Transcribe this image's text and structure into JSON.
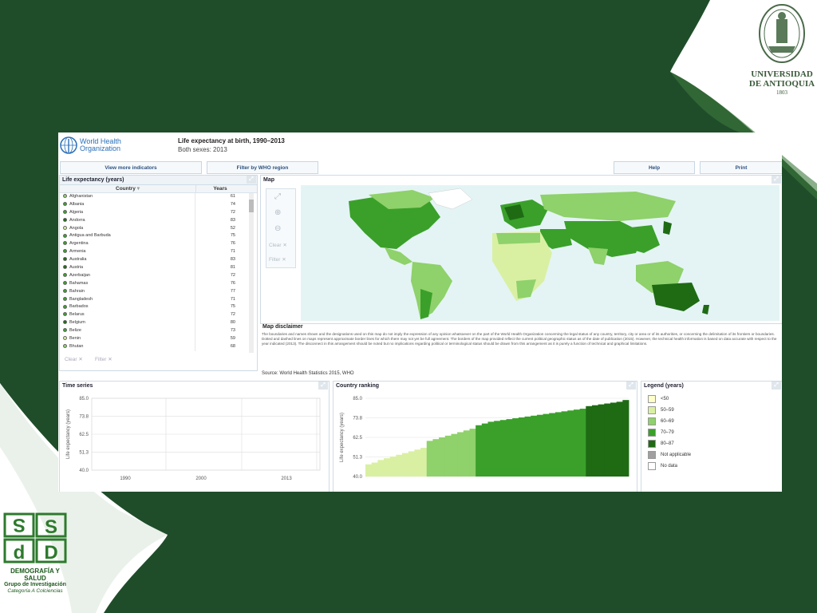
{
  "slide": {
    "colors": {
      "dark_green": "#1f4d2a",
      "accent_green": "#2d7a2d"
    },
    "udea_logo": {
      "name": "UNIVERSIDAD DE ANTIOQUIA",
      "line1": "UNIVERSIDAD",
      "line2": "DE ANTIOQUIA",
      "year": "1803"
    },
    "ds_logo": {
      "line1": "DEMOGRAFÍA Y SALUD",
      "line2": "Grupo de Investigación",
      "line3": "Categoría A Colciencias"
    }
  },
  "who": {
    "org_line1": "World Health",
    "org_line2": "Organization",
    "title": "Life expectancy at birth, 1990–2013",
    "subtitle": "Both sexes: 2013",
    "buttons": {
      "more": "View more indicators",
      "filter": "Filter by WHO region",
      "help": "Help",
      "print": "Print"
    },
    "list_panel": {
      "title": "Life expectancy (years)",
      "col_country": "Country",
      "col_years": "Years",
      "rows": [
        {
          "country": "Afghanistan",
          "years": "61"
        },
        {
          "country": "Albania",
          "years": "74"
        },
        {
          "country": "Algeria",
          "years": "72"
        },
        {
          "country": "Andorra",
          "years": "83"
        },
        {
          "country": "Angola",
          "years": "52"
        },
        {
          "country": "Antigua and Barbuda",
          "years": "75"
        },
        {
          "country": "Argentina",
          "years": "76"
        },
        {
          "country": "Armenia",
          "years": "71"
        },
        {
          "country": "Australia",
          "years": "83"
        },
        {
          "country": "Austria",
          "years": "81"
        },
        {
          "country": "Azerbaijan",
          "years": "72"
        },
        {
          "country": "Bahamas",
          "years": "76"
        },
        {
          "country": "Bahrain",
          "years": "77"
        },
        {
          "country": "Bangladesh",
          "years": "71"
        },
        {
          "country": "Barbados",
          "years": "75"
        },
        {
          "country": "Belarus",
          "years": "72"
        },
        {
          "country": "Belgium",
          "years": "80"
        },
        {
          "country": "Belize",
          "years": "73"
        },
        {
          "country": "Benin",
          "years": "59"
        },
        {
          "country": "Bhutan",
          "years": "68"
        }
      ],
      "clear": "Clear",
      "filter": "Filter"
    },
    "map_panel": {
      "title": "Map",
      "clear": "Clear",
      "filter": "Filter"
    },
    "disclaimer": {
      "title": "Map disclaimer",
      "text": "The boundaries and names shown and the designations used on this map do not imply the expression of any opinion whatsoever on the part of the World Health Organization concerning the legal status of any country, territory, city or area or of its authorities, or concerning the delimitation of its frontiers or boundaries. Dotted and dashed lines on maps represent approximate border lines for which there may not yet be full agreement. The borders of the map provided reflect the current political geographic status as of the date of publication (2015). However, the technical health information is based on data accurate with respect to the year indicated (2013). The disconnect in this arrangement should be noted but no implications regarding political or terminological status should be drawn from this arrangement as it is purely a function of technical and graphical limitations."
    },
    "source": "Source: World Health Statistics 2015, WHO",
    "legend": {
      "title": "Legend (years)",
      "items": [
        {
          "label": "<50",
          "color": "#ffffcc"
        },
        {
          "label": "50–59",
          "color": "#d9f0a3"
        },
        {
          "label": "60–69",
          "color": "#8fd16a"
        },
        {
          "label": "70–79",
          "color": "#3aa02a"
        },
        {
          "label": "80–87",
          "color": "#1e6b14"
        },
        {
          "label": "Not applicable",
          "color": "#a0a0a0"
        },
        {
          "label": "No data",
          "color": "#ffffff"
        }
      ]
    }
  },
  "chart_data": [
    {
      "type": "line",
      "title": "Time series",
      "ylabel": "Life expectancy (years)",
      "x": [
        "1990",
        "2000",
        "2013"
      ],
      "yticks": [
        "85.0",
        "73.8",
        "62.5",
        "51.3",
        "40.0"
      ],
      "ylim": [
        40,
        85
      ],
      "series": []
    },
    {
      "type": "bar",
      "title": "Country ranking",
      "ylabel": "Life expectancy (years)",
      "yticks": [
        "85.0",
        "73.8",
        "62.5",
        "51.3",
        "40.0"
      ],
      "ylim": [
        40,
        85
      ],
      "series": [
        {
          "color": "#d9f0a3",
          "values": [
            47,
            48,
            49.5,
            50.5,
            51.5,
            52.5,
            53.5,
            54.5,
            55.5,
            56.5
          ]
        },
        {
          "color": "#8fd16a",
          "values": [
            60.5,
            61.5,
            62.5,
            63.5,
            64.5,
            65.5,
            66.5,
            67.5
          ]
        },
        {
          "color": "#3aa02a",
          "values": [
            69.5,
            70.5,
            71.5,
            72,
            72.5,
            73,
            73.5,
            74,
            74.5,
            75,
            75.5,
            76,
            76.5,
            77,
            77.5,
            78,
            78.5,
            79
          ]
        },
        {
          "color": "#1e6b14",
          "values": [
            80.5,
            81,
            81.5,
            82,
            82.5,
            83,
            84
          ]
        }
      ]
    }
  ]
}
